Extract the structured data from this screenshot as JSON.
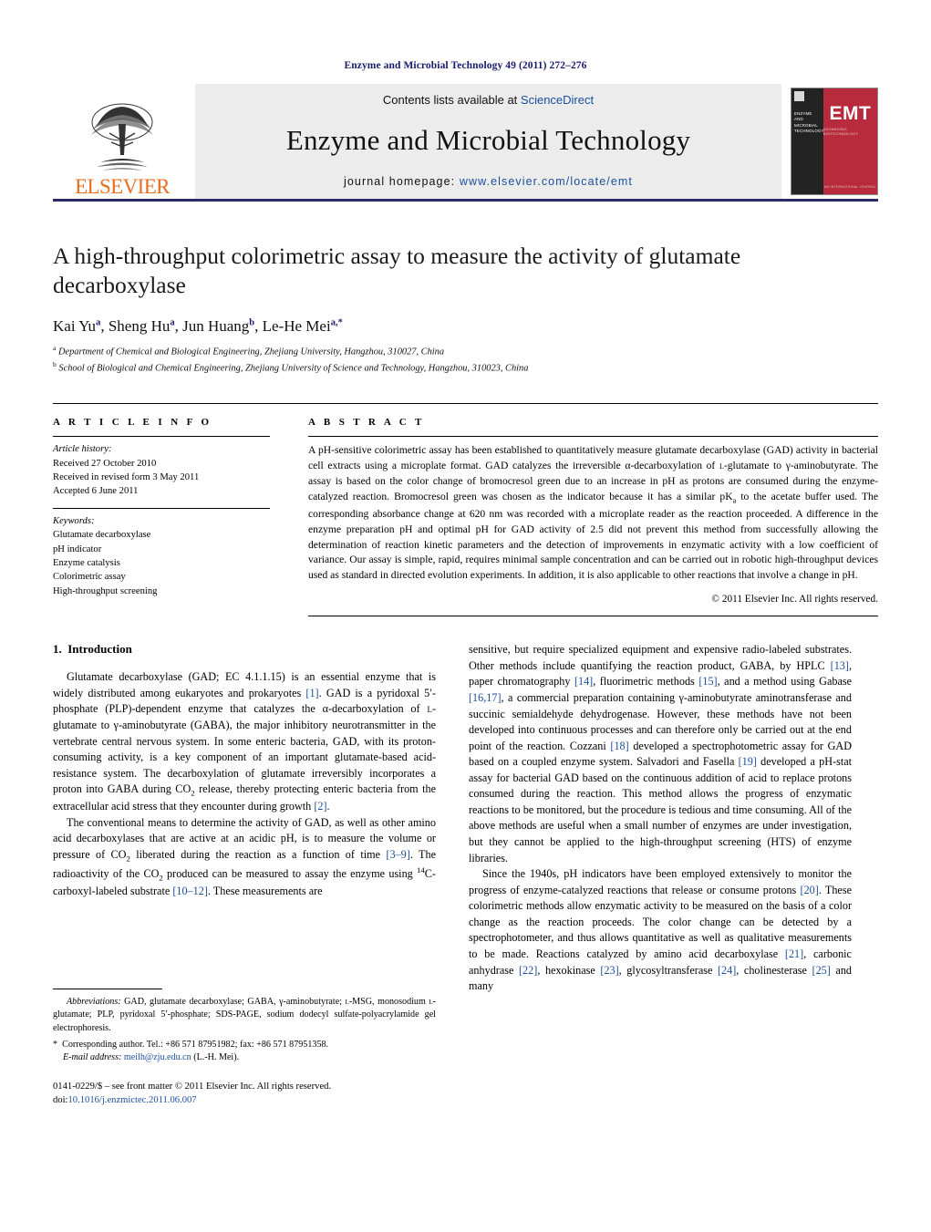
{
  "running_head": "Enzyme and Microbial Technology 49 (2011) 272–276",
  "masthead": {
    "elsevier_word": "ELSEVIER",
    "contents_line": "Contents lists available at ",
    "sciencedirect": "ScienceDirect",
    "journal_title": "Enzyme and Microbial Technology",
    "homepage_label": "journal homepage: ",
    "homepage_url": "www.elsevier.com/locate/emt",
    "cover": {
      "spine_text": "ENZYME AND MICROBIAL TECHNOLOGY",
      "acronym": "EMT",
      "subtitle": "ADVANCING BIOTECHNOLOGY",
      "footer": "AN INTERNATIONAL JOURNAL"
    }
  },
  "article": {
    "title": "A high-throughput colorimetric assay to measure the activity of glutamate decarboxylase",
    "authors": [
      {
        "name": "Kai Yu",
        "marks": "a"
      },
      {
        "name": "Sheng Hu",
        "marks": "a"
      },
      {
        "name": "Jun Huang",
        "marks": "b"
      },
      {
        "name": "Le-He Mei",
        "marks": "a,*"
      }
    ],
    "affiliations": [
      {
        "mark": "a",
        "text": "Department of Chemical and Biological Engineering, Zhejiang University, Hangzhou, 310027, China"
      },
      {
        "mark": "b",
        "text": "School of Biological and Chemical Engineering, Zhejiang University of Science and Technology, Hangzhou, 310023, China"
      }
    ]
  },
  "article_info": {
    "heading": "A R T I C L E   I N F O",
    "history_label": "Article history:",
    "history": [
      "Received 27 October 2010",
      "Received in revised form 3 May 2011",
      "Accepted 6 June 2011"
    ],
    "keywords_label": "Keywords:",
    "keywords": [
      "Glutamate decarboxylase",
      "pH indicator",
      "Enzyme catalysis",
      "Colorimetric assay",
      "High-throughput screening"
    ]
  },
  "abstract": {
    "heading": "A B S T R A C T",
    "copyright": "© 2011 Elsevier Inc. All rights reserved."
  },
  "intro": {
    "section_number": "1.",
    "section_title": "Introduction"
  },
  "footnotes": {
    "abbrev_label": "Abbreviations:",
    "corresponding": "Corresponding author. Tel.: +86 571 87951982; fax: +86 571 87951358.",
    "email_label": "E-mail address:",
    "email": "meilh@zju.edu.cn",
    "email_owner": "(L.-H. Mei).",
    "imprint": "0141-0229/$ – see front matter © 2011 Elsevier Inc. All rights reserved.",
    "doi_label": "doi:",
    "doi": "10.1016/j.enzmictec.2011.06.007"
  }
}
